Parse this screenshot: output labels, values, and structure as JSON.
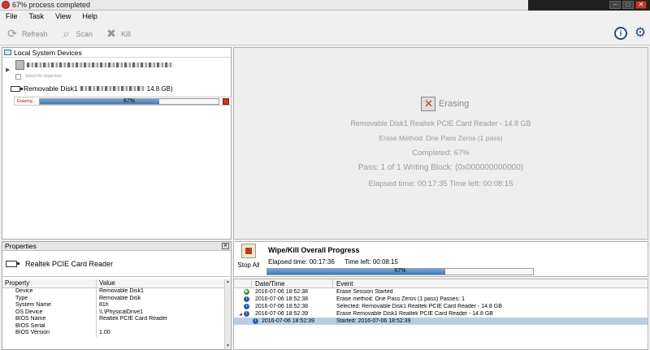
{
  "window": {
    "title": "67% process completed"
  },
  "menu": [
    "File",
    "Task",
    "View",
    "Help"
  ],
  "toolbar": {
    "refresh": "Refresh",
    "scan": "Scan",
    "kill": "Kill"
  },
  "devices": {
    "header": "Local System Devices",
    "select_text": "Select for inspection",
    "removable_label": "Removable Disk1",
    "removable_size": "14.8 GB)",
    "status": "Erasing...",
    "progress_percent": 67,
    "progress_label": "67%"
  },
  "erase_panel": {
    "heading": "Erasing",
    "device": "Removable Disk1 Realtek PCIE Card Reader - 14.8 GB",
    "method": "Erase Method: One Pass Zeros (1 pass)",
    "completed": "Completed: 67%",
    "pass": "Pass: 1 of 1 Writing Block: (0x000000000000)",
    "elapsed": "Elapsed time: 00:17:35 Time left: 00:08:15"
  },
  "properties": {
    "header": "Properties",
    "device_name": "Realtek PCIE Card Reader",
    "col_property": "Property",
    "col_value": "Value",
    "rows": [
      {
        "k": "Device",
        "v": "Removable Disk1"
      },
      {
        "k": "Type",
        "v": "Removable Disk"
      },
      {
        "k": "System Name",
        "v": "81h"
      },
      {
        "k": "OS Device",
        "v": "\\\\.\\PhysicalDrive1"
      },
      {
        "k": "BIOS Name",
        "v": "Realtek PCIE Card Reader"
      },
      {
        "k": "BIOS Serial",
        "v": ""
      },
      {
        "k": "BIOS Version",
        "v": "1.00"
      }
    ]
  },
  "overall": {
    "stop_label": "Stop All",
    "title": "Wipe/Kill Overall Progress",
    "elapsed": "Elapsed time: 00:17:36",
    "time_left": "Time left: 00:08:15",
    "progress_percent": 67,
    "progress_label": "67%"
  },
  "log": {
    "col_date": "Date/Time",
    "col_event": "Event",
    "rows": [
      {
        "date": "2016-07-06 18:52:38",
        "event": "Erase Session Started",
        "icon": "green"
      },
      {
        "date": "2016-07-06 18:52:38",
        "event": "Erase method: One Pass Zeros (1 pass) Passes: 1",
        "icon": "blue"
      },
      {
        "date": "2016-07-06 18:52:38",
        "event": "Selected: Removable Disk1 Realtek PCIE Card Reader - 14.8 GB",
        "icon": "blue"
      },
      {
        "date": "2016-07-06 18:52:39",
        "event": "Erase Removable Disk1 Realtek PCIE Card Reader - 14.8 GB",
        "icon": "blue"
      },
      {
        "date": "2016-07-06 18:52:39",
        "event": "Started: 2016-07-06 18:52:39",
        "icon": "blue"
      }
    ]
  },
  "colors": {
    "progress": "#3c79b8",
    "selection": "#b9cde4",
    "stop": "#c0392b"
  }
}
